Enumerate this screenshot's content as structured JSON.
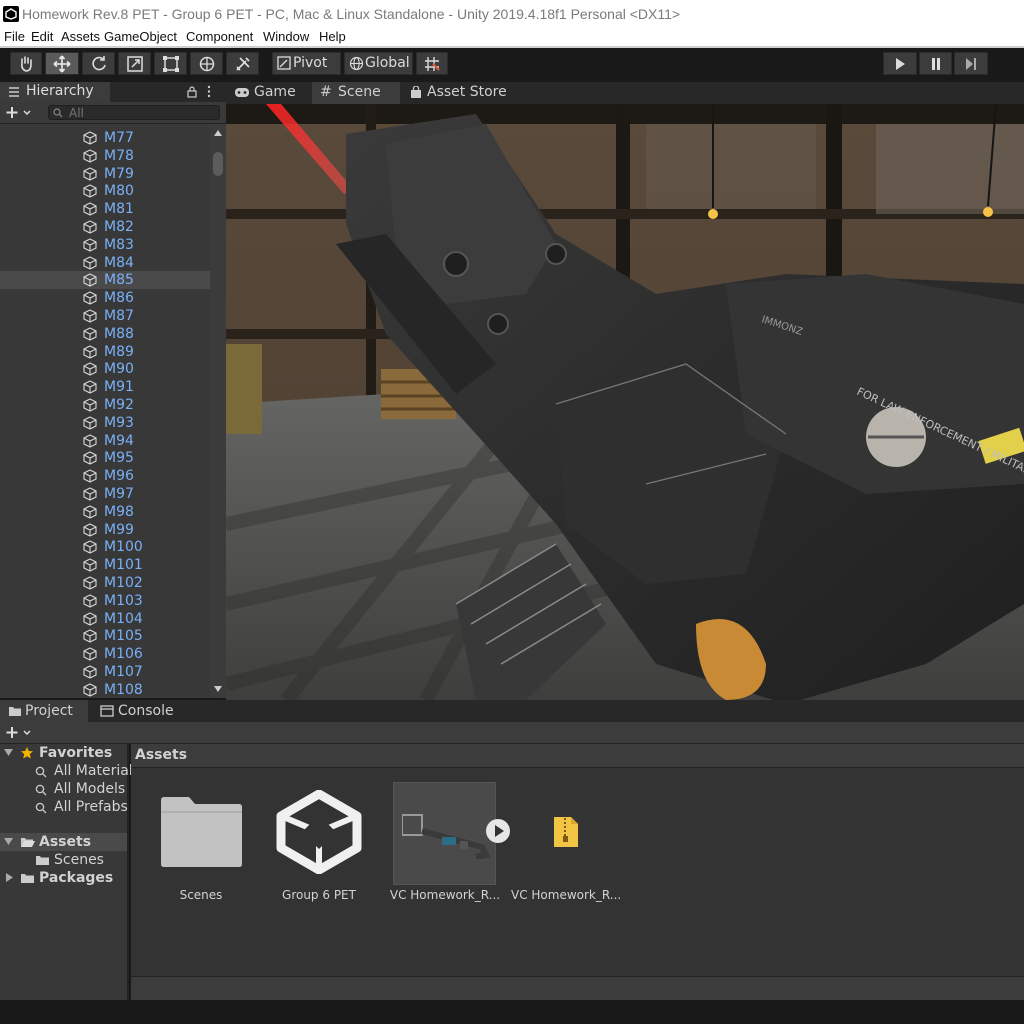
{
  "window": {
    "title": "Homework Rev.8 PET - Group 6 PET - PC, Mac & Linux Standalone - Unity 2019.4.18f1 Personal <DX11>"
  },
  "menu": [
    "File",
    "Edit",
    "Assets",
    "GameObject",
    "Component",
    "Window",
    "Help"
  ],
  "toolbar": {
    "tools": [
      "hand-tool",
      "move-tool",
      "rotate-tool",
      "scale-tool",
      "rect-tool",
      "transform-tool",
      "custom-tool"
    ],
    "active_tool": "move-tool",
    "pivot_label": "Pivot",
    "global_label": "Global",
    "play_controls": [
      "play",
      "pause",
      "step"
    ]
  },
  "hierarchy": {
    "tab_label": "Hierarchy",
    "search_placeholder": "All",
    "items": [
      "M77",
      "M78",
      "M79",
      "M80",
      "M81",
      "M82",
      "M83",
      "M84",
      "M85",
      "M86",
      "M87",
      "M88",
      "M89",
      "M90",
      "M91",
      "M92",
      "M93",
      "M94",
      "M95",
      "M96",
      "M97",
      "M98",
      "M99",
      "M100",
      "M101",
      "M102",
      "M103",
      "M104",
      "M105",
      "M106",
      "M107",
      "M108"
    ],
    "selected": "M85"
  },
  "scene": {
    "tabs": [
      "Game",
      "Scene",
      "Asset Store"
    ],
    "active_tab": "Scene",
    "weapon_text_1": "FOR LAW ENFORCEMENT / MILITARY USE",
    "weapon_text_2": "IMMONZ"
  },
  "project": {
    "tabs": [
      "Project",
      "Console"
    ],
    "active_tab": "Project",
    "favorites": {
      "label": "Favorites",
      "items": [
        "All Materials",
        "All Models",
        "All Prefabs"
      ]
    },
    "tree": {
      "assets_label": "Assets",
      "scenes_label": "Scenes",
      "packages_label": "Packages"
    },
    "breadcrumb": "Assets",
    "assets": [
      {
        "label": "Scenes",
        "type": "folder"
      },
      {
        "label": "Group 6 PET",
        "type": "unity-scene"
      },
      {
        "label": "VC Homework_R...",
        "type": "prefab"
      },
      {
        "label": "VC Homework_R...",
        "type": "zip"
      }
    ]
  },
  "colors": {
    "accent_link": "#7ab0f5",
    "panel": "#383838",
    "dark": "#191919",
    "favorite_star": "#f0b400"
  }
}
